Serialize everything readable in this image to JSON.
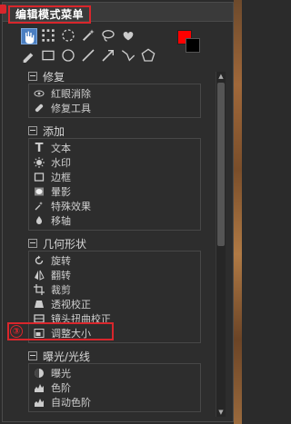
{
  "panel": {
    "title": "编辑模式菜单",
    "annotation_number": "③"
  },
  "toolbar": {
    "row1": [
      "hand-icon",
      "dots-select-icon",
      "circle-dots-icon",
      "magic-wand-icon",
      "lasso-icon",
      "brush-select-icon"
    ],
    "row2": [
      "eyedropper-icon",
      "rect-icon",
      "ellipse-icon",
      "line-icon",
      "arrow-icon",
      "polyline-icon",
      "polygon-icon"
    ],
    "foreground_color": "#ff0000",
    "background_color": "#000000"
  },
  "groups": [
    {
      "label": "修复",
      "items": [
        {
          "label": "紅眼消除",
          "icon": "eye-icon"
        },
        {
          "label": "修复工具",
          "icon": "bandage-icon"
        }
      ]
    },
    {
      "label": "添加",
      "items": [
        {
          "label": "文本",
          "icon": "text-icon"
        },
        {
          "label": "水印",
          "icon": "watermark-icon"
        },
        {
          "label": "边框",
          "icon": "frame-icon"
        },
        {
          "label": "暈影",
          "icon": "vignette-icon"
        },
        {
          "label": "特殊效果",
          "icon": "sparkle-icon"
        },
        {
          "label": "移轴",
          "icon": "tilt-shift-icon"
        }
      ]
    },
    {
      "label": "几何形状",
      "items": [
        {
          "label": "旋转",
          "icon": "rotate-icon"
        },
        {
          "label": "翻转",
          "icon": "flip-icon"
        },
        {
          "label": "裁剪",
          "icon": "crop-icon"
        },
        {
          "label": "透视校正",
          "icon": "perspective-icon"
        },
        {
          "label": "镜头扭曲校正",
          "icon": "lens-icon"
        },
        {
          "label": "调整大小",
          "icon": "resize-icon"
        }
      ]
    },
    {
      "label": "曝光/光线",
      "items": [
        {
          "label": "曝光",
          "icon": "exposure-icon"
        },
        {
          "label": "色阶",
          "icon": "levels-icon"
        },
        {
          "label": "自动色阶",
          "icon": "auto-levels-icon"
        }
      ]
    }
  ]
}
